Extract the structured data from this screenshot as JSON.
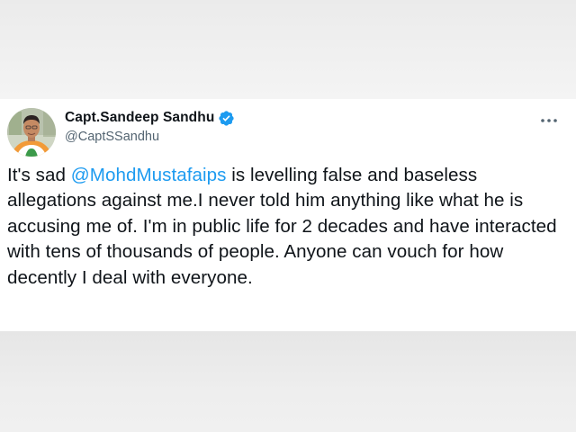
{
  "tweet": {
    "author": {
      "display_name": "Capt.Sandeep Sandhu",
      "handle": "@CaptSSandhu",
      "verified": true,
      "avatar_icon": "profile-photo"
    },
    "text_before": "It's sad ",
    "mention": "@MohdMustafaips",
    "text_after": " is levelling false and baseless allegations against me.I never told him anything like what he is accusing me of. I'm in public life for 2 decades and have interacted with tens of thousands of people. Anyone can vouch for how decently I deal with everyone.",
    "more_icon": "more-horizontal-icon"
  },
  "colors": {
    "accent": "#1d9bf0",
    "text": "#0f1419",
    "secondary_text": "#536471",
    "verified_badge": "#1d9bf0",
    "card_background": "#ffffff",
    "page_background": "#eeeeee"
  }
}
